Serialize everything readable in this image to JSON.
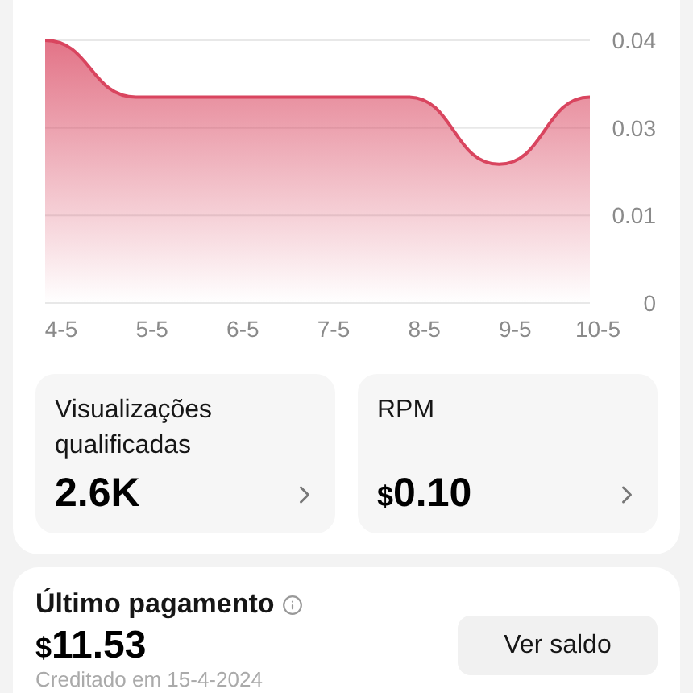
{
  "chart": {
    "chart_data": {
      "type": "area",
      "categories": [
        "4-5",
        "5-5",
        "6-5",
        "7-5",
        "8-5",
        "9-5",
        "10-5"
      ],
      "series": [
        {
          "color": "#d9455f",
          "values": [
            0.0375,
            0.0294,
            0.0294,
            0.0294,
            0.0294,
            0.0198,
            0.0294
          ]
        }
      ],
      "ylim": [
        0,
        0.0375
      ],
      "grid": true,
      "yticks": [
        {
          "value": 0.0375,
          "label": "0.04"
        },
        {
          "value": 0.025,
          "label": "0.03"
        },
        {
          "value": 0.0125,
          "label": "0.01"
        },
        {
          "value": 0,
          "label": "0"
        }
      ]
    }
  },
  "stats": [
    {
      "label": "Visualizações qualificadas",
      "amount": "2.6K"
    },
    {
      "label": "RPM",
      "currency": "$",
      "amount": "0.10"
    }
  ],
  "payment": {
    "title": "Último pagamento",
    "currency": "$",
    "amount": "11.53",
    "note": "Creditado em 15-4-2024",
    "button": "Ver saldo"
  }
}
